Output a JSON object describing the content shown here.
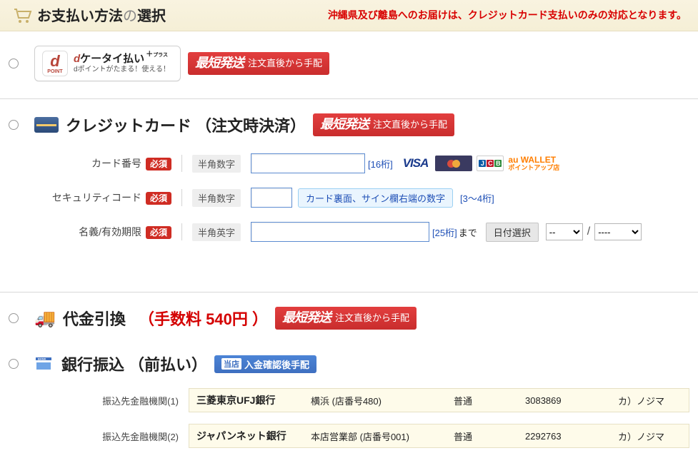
{
  "header": {
    "title_pre": "お支払い方法",
    "title_no": "の",
    "title_post": "選択",
    "warning": "沖縄県及び離島へのお届けは、クレジットカード支払いのみの対応となります。"
  },
  "badge_fast": {
    "big": "最短発送",
    "small": "注文直後から手配"
  },
  "badge_bank": {
    "lead": "当店",
    "text": "入金確認後手配"
  },
  "d_keitai": {
    "point_label": "d",
    "point_sub": "POINT",
    "line1_head": "d",
    "line1": "ケータイ払い",
    "plus": "プラス",
    "line2": "dポイントがたまる！使える！"
  },
  "cc": {
    "title_a": "クレジットカード",
    "title_b": "（注文時決済）",
    "label_card": "カード番号",
    "label_sec": "セキュリティコード",
    "label_name": "名義/有効期限",
    "req": "必須",
    "hint_num": "半角数字",
    "hint_alpha": "半角英字",
    "digits16": "[16桁]",
    "digits34": "[3〜4桁]",
    "digits25": "[25桁]",
    "until": "まで",
    "tip": "カード裏面、サイン欄右端の数字",
    "date_btn": "日付選択",
    "month_default": "--",
    "year_default": "----",
    "brands": {
      "visa": "VISA",
      "au_top": "au WALLET",
      "au_sub": "ポイントアップ店"
    }
  },
  "cod": {
    "title": "代金引換",
    "fee": "（手数料 540円 ）"
  },
  "bank": {
    "title_a": "銀行振込",
    "title_b": "（前払い）",
    "lab1": "振込先金融機関(1)",
    "lab2": "振込先金融機関(2)",
    "rows": [
      {
        "bank": "三菱東京UFJ銀行",
        "branch": "横浜 (店番号480)",
        "type": "普通",
        "acct": "3083869",
        "holder": "カ）ノジマ"
      },
      {
        "bank": "ジャパンネット銀行",
        "branch": "本店営業部 (店番号001)",
        "type": "普通",
        "acct": "2292763",
        "holder": "カ）ノジマ"
      }
    ]
  }
}
